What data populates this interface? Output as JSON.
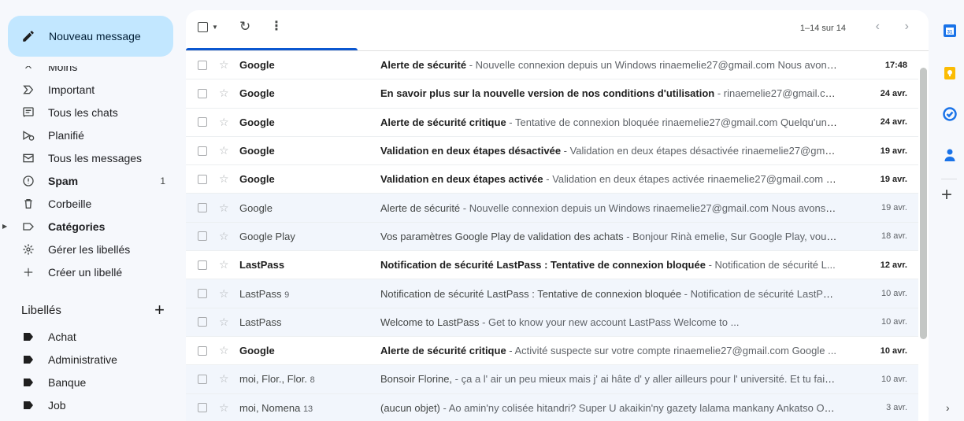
{
  "compose": {
    "label": "Nouveau message"
  },
  "nav": {
    "items": [
      {
        "label": "Moins",
        "icon": "chevron-up-icon",
        "count": ""
      },
      {
        "label": "Important",
        "icon": "important-icon",
        "count": ""
      },
      {
        "label": "Tous les chats",
        "icon": "chat-icon",
        "count": ""
      },
      {
        "label": "Planifié",
        "icon": "scheduled-icon",
        "count": ""
      },
      {
        "label": "Tous les messages",
        "icon": "all-mail-icon",
        "count": ""
      },
      {
        "label": "Spam",
        "icon": "spam-icon",
        "count": "1"
      },
      {
        "label": "Corbeille",
        "icon": "trash-icon",
        "count": ""
      },
      {
        "label": "Catégories",
        "icon": "category-icon",
        "count": ""
      },
      {
        "label": "Gérer les libellés",
        "icon": "settings-icon",
        "count": ""
      },
      {
        "label": "Créer un libellé",
        "icon": "plus-icon",
        "count": ""
      }
    ]
  },
  "labels": {
    "title": "Libellés",
    "items": [
      {
        "label": "Achat"
      },
      {
        "label": "Administrative"
      },
      {
        "label": "Banque"
      },
      {
        "label": "Job"
      }
    ]
  },
  "toolbar": {
    "count": "1–14 sur 14"
  },
  "emails": [
    {
      "sender": "Google",
      "num": "",
      "subject": "Alerte de sécurité",
      "snippet": " - Nouvelle connexion depuis un Windows rinaemelie27@gmail.com Nous avons ...",
      "date": "17:48",
      "unread": true
    },
    {
      "sender": "Google",
      "num": "",
      "subject": "En savoir plus sur la nouvelle version de nos conditions d'utilisation",
      "snippet": " - rinaemelie27@gmail.com...",
      "date": "24 avr.",
      "unread": true
    },
    {
      "sender": "Google",
      "num": "",
      "subject": "Alerte de sécurité critique",
      "snippet": " - Tentative de connexion bloquée rinaemelie27@gmail.com Quelqu'un ...",
      "date": "24 avr.",
      "unread": true
    },
    {
      "sender": "Google",
      "num": "",
      "subject": "Validation en deux étapes désactivée",
      "snippet": " - Validation en deux étapes désactivée rinaemelie27@gmai...",
      "date": "19 avr.",
      "unread": true
    },
    {
      "sender": "Google",
      "num": "",
      "subject": "Validation en deux étapes activée",
      "snippet": " - Validation en deux étapes activée rinaemelie27@gmail.com V...",
      "date": "19 avr.",
      "unread": true
    },
    {
      "sender": "Google",
      "num": "",
      "subject": "Alerte de sécurité",
      "snippet": " - Nouvelle connexion depuis un Windows rinaemelie27@gmail.com Nous avons d...",
      "date": "19 avr.",
      "unread": false
    },
    {
      "sender": "Google Play",
      "num": "",
      "subject": "Vos paramètres Google Play de validation des achats",
      "snippet": " - Bonjour Rinà emelie, Sur Google Play, vous p...",
      "date": "18 avr.",
      "unread": false
    },
    {
      "sender": "LastPass",
      "num": "",
      "subject": "Notification de sécurité LastPass : Tentative de connexion bloquée",
      "snippet": " - Notification de sécurité L...",
      "date": "12 avr.",
      "unread": true
    },
    {
      "sender": "LastPass",
      "num": "9",
      "subject": "Notification de sécurité LastPass : Tentative de connexion bloquée",
      "snippet": " - Notification de sécurité LastPa...",
      "date": "10 avr.",
      "unread": false
    },
    {
      "sender": "LastPass",
      "num": "",
      "subject": "Welcome to LastPass",
      "snippet": " - Get to know your new account                          LastPass Welcome to ...",
      "date": "10 avr.",
      "unread": false
    },
    {
      "sender": "Google",
      "num": "",
      "subject": "Alerte de sécurité critique",
      "snippet": " - Activité suspecte sur votre compte rinaemelie27@gmail.com Google ...",
      "date": "10 avr.",
      "unread": true
    },
    {
      "sender": "moi, Flor., Flor.",
      "num": "8",
      "subject": "Bonsoir Florine,",
      "snippet": " - ça a l' air un peu mieux mais j' ai hâte d' y aller ailleurs pour l' université. Et tu fais ...",
      "date": "10 avr.",
      "unread": false
    },
    {
      "sender": "moi, Nomena",
      "num": "13",
      "subject": "(aucun objet)",
      "snippet": " - Ao amin'ny colisée hitandri? Super U akaikin'ny gazety lalama mankany Ankatso On ...",
      "date": "3 avr.",
      "unread": false
    }
  ],
  "side_panel": {
    "icons": [
      "calendar-icon",
      "keep-icon",
      "tasks-icon",
      "contacts-icon"
    ],
    "colors": {
      "calendar": "#1a73e8",
      "keep": "#fbbc04",
      "tasks": "#1a73e8",
      "contacts": "#1a73e8"
    }
  },
  "colors": {
    "compose_bg": "#c2e7ff",
    "accent": "#0b57d0",
    "read_row_bg": "#f2f6fc"
  }
}
